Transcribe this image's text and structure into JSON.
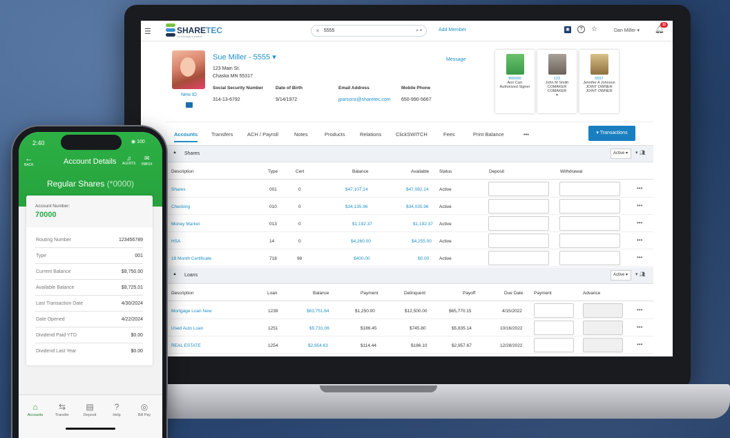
{
  "laptop": {
    "topbar": {
      "brand": "SHARETEC",
      "brand_prefix": "SHARE",
      "brand_suffix": "TEC",
      "tagline": "The technology of simplicity",
      "search_value": "5555",
      "add_member": "Add Member",
      "user": "Dan Miller ▾",
      "notifications": "11"
    },
    "member": {
      "name": "Sue Miller - 5555 ▾",
      "address1": "123 Main St.",
      "address2": "Chaska MN 55317",
      "new_id": "New ID",
      "message": "Message",
      "fields": [
        {
          "label": "Social Security Number",
          "value": "314-13-6792"
        },
        {
          "label": "Date of Birth",
          "value": "9/14/1972"
        },
        {
          "label": "Email Address",
          "value": "jparsons@sharetec.com"
        },
        {
          "label": "Mobile Phone",
          "value": "650-990-5667"
        }
      ],
      "relations": [
        {
          "id": "800000",
          "name": "Ann Carr",
          "role1": "Authorized Signer",
          "role2": ""
        },
        {
          "id": "123",
          "name": "John M Smith",
          "role1": "COMAKER",
          "role2": "COMAKER"
        },
        {
          "id": "5557",
          "name": "Jennifer A Johnson",
          "role1": "JOINT OWNER",
          "role2": "JOINT OWNER"
        }
      ]
    },
    "tabs": [
      "Accounts",
      "Transfers",
      "ACH / Payroll",
      "Notes",
      "Products",
      "Relations",
      "ClickSWITCH",
      "Fees",
      "Print Balance",
      "•••"
    ],
    "transactions_button": "Transactions",
    "shares": {
      "title": "Shares",
      "filter": "Active ▾",
      "columns": [
        "Description",
        "Type",
        "Cert",
        "Balance",
        "Available",
        "Status",
        "Deposit",
        "Withdrawal"
      ],
      "rows": [
        {
          "desc": "Shares",
          "type": "001",
          "cert": "0",
          "balance": "$47,107.14",
          "available": "$47,082.14",
          "status": "Active"
        },
        {
          "desc": "Checking",
          "type": "010",
          "cert": "0",
          "balance": "$34,135.96",
          "available": "$34,035.96",
          "status": "Active"
        },
        {
          "desc": "Money Market",
          "type": "013",
          "cert": "0",
          "balance": "$1,192.37",
          "available": "$1,192.37",
          "status": "Active"
        },
        {
          "desc": "HSA",
          "type": "14",
          "cert": "0",
          "balance": "$4,260.00",
          "available": "$4,255.00",
          "status": "Active"
        },
        {
          "desc": "18 Month Certificate",
          "type": "718",
          "cert": "98",
          "balance": "$400.00",
          "available": "$0.00",
          "status": "Active"
        }
      ]
    },
    "loans": {
      "title": "Loans",
      "filter": "Active ▾",
      "columns": [
        "Description",
        "Loan",
        "Balance",
        "Payment",
        "Delinquent",
        "Payoff",
        "Due Date",
        "Payment",
        "Advance"
      ],
      "rows": [
        {
          "desc": "Mortgage Loan New",
          "loan": "1239",
          "balance": "$63,751.84",
          "payment": "$1,250.00",
          "delinquent": "$12,500.00",
          "payoff": "$65,770.15",
          "due": "4/15/2022"
        },
        {
          "desc": "Used Auto Loan",
          "loan": "1251",
          "balance": "$5,731.06",
          "payment": "$186.45",
          "delinquent": "$745.80",
          "payoff": "$5,835.14",
          "due": "10/16/2022"
        },
        {
          "desc": "REAL ESTATE",
          "loan": "1254",
          "balance": "$2,954.63",
          "payment": "$114.44",
          "delinquent": "$186.10",
          "payoff": "$2,957.67",
          "due": "12/28/2022"
        }
      ]
    },
    "row_menu": "•••"
  },
  "phone": {
    "time": "2:40",
    "battery": "100",
    "back": "BACK",
    "title": "Account Details",
    "alerts": "ALERTS",
    "inbox": "INBOX",
    "account_name": "Regular Shares",
    "account_suffix": "(*0000)",
    "account_number_label": "Account Number:",
    "account_number": "70000",
    "details": [
      {
        "k": "Routing Number",
        "v": "123456789"
      },
      {
        "k": "Type",
        "v": "001"
      },
      {
        "k": "Current Balance",
        "v": "$9,750.00"
      },
      {
        "k": "Available Balance",
        "v": "$9,725.01"
      },
      {
        "k": "Last Transaction Date",
        "v": "4/30/2024"
      },
      {
        "k": "Date Opened",
        "v": "4/22/2024"
      },
      {
        "k": "Dividend Paid YTD",
        "v": "$0.00"
      },
      {
        "k": "Dividend Last Year",
        "v": "$0.00"
      }
    ],
    "tabbar": [
      {
        "label": "Accounts",
        "icon": "⌂"
      },
      {
        "label": "Transfer",
        "icon": "⇆"
      },
      {
        "label": "Deposit",
        "icon": "▤"
      },
      {
        "label": "Help",
        "icon": "?"
      },
      {
        "label": "Bill Pay",
        "icon": "◎"
      }
    ]
  }
}
